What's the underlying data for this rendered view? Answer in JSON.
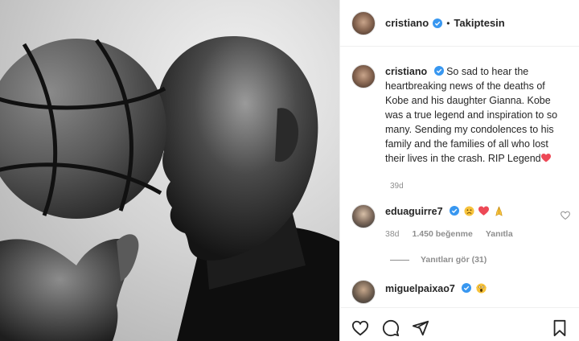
{
  "post": {
    "username": "cristiano",
    "follow_state": "Takiptesin",
    "separator": "•"
  },
  "caption": {
    "username": "cristiano",
    "text": "So sad to hear the heartbreaking news of the deaths of Kobe and his daughter Gianna. Kobe was a true legend and inspiration to so many. Sending my condolences to his family and the families of all who lost their lives in the crash. RIP Legend",
    "age": "39d"
  },
  "comments": [
    {
      "username": "eduaguirre7",
      "age": "38d",
      "likes": "1.450 beğenme",
      "reply_label": "Yanıtla",
      "emojis": [
        "sad-face",
        "red-heart",
        "folded-hands"
      ]
    },
    {
      "username": "miguelpaixao7",
      "emojis": [
        "screaming-face"
      ]
    }
  ],
  "replies": {
    "label": "Yanıtları gör (31)"
  },
  "icons": {
    "like": "heart-outline-icon",
    "comment": "comment-bubble-icon",
    "share": "paper-plane-icon",
    "save": "bookmark-icon",
    "verified": "verified-badge-icon"
  },
  "colors": {
    "verified": "#3897f0",
    "heart_red": "#ed4956",
    "muted_text": "#8e8e8e",
    "text": "#262626"
  }
}
